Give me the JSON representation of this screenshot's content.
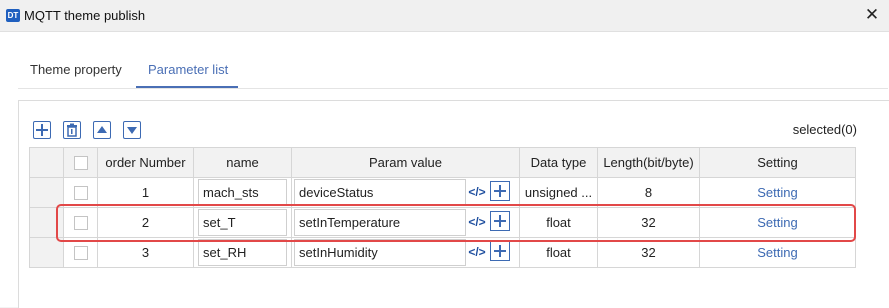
{
  "window": {
    "title": "MQTT theme publish",
    "icon_text": "DT"
  },
  "tabs": [
    {
      "label": "Theme property",
      "active": false
    },
    {
      "label": "Parameter list",
      "active": true
    }
  ],
  "toolbar": {
    "buttons": [
      "add-icon",
      "delete-icon",
      "move-up-icon",
      "move-down-icon"
    ],
    "selected_label": "selected(0)"
  },
  "table": {
    "columns": [
      "",
      "",
      "order Number",
      "name",
      "Param value",
      "Data type",
      "Length(bit/byte)",
      "Setting"
    ],
    "rows": [
      {
        "order": "1",
        "name": "mach_sts",
        "param": "deviceStatus",
        "data_type": "unsigned ...",
        "length": "8",
        "setting": "Setting",
        "highlighted": true
      },
      {
        "order": "2",
        "name": "set_T",
        "param": "setInTemperature",
        "data_type": "float",
        "length": "32",
        "setting": "Setting",
        "highlighted": false
      },
      {
        "order": "3",
        "name": "set_RH",
        "param": "setInHumidity",
        "data_type": "float",
        "length": "32",
        "setting": "Setting",
        "highlighted": false
      }
    ]
  },
  "colors": {
    "accent": "#3d6ab3",
    "highlight": "#e24848"
  }
}
